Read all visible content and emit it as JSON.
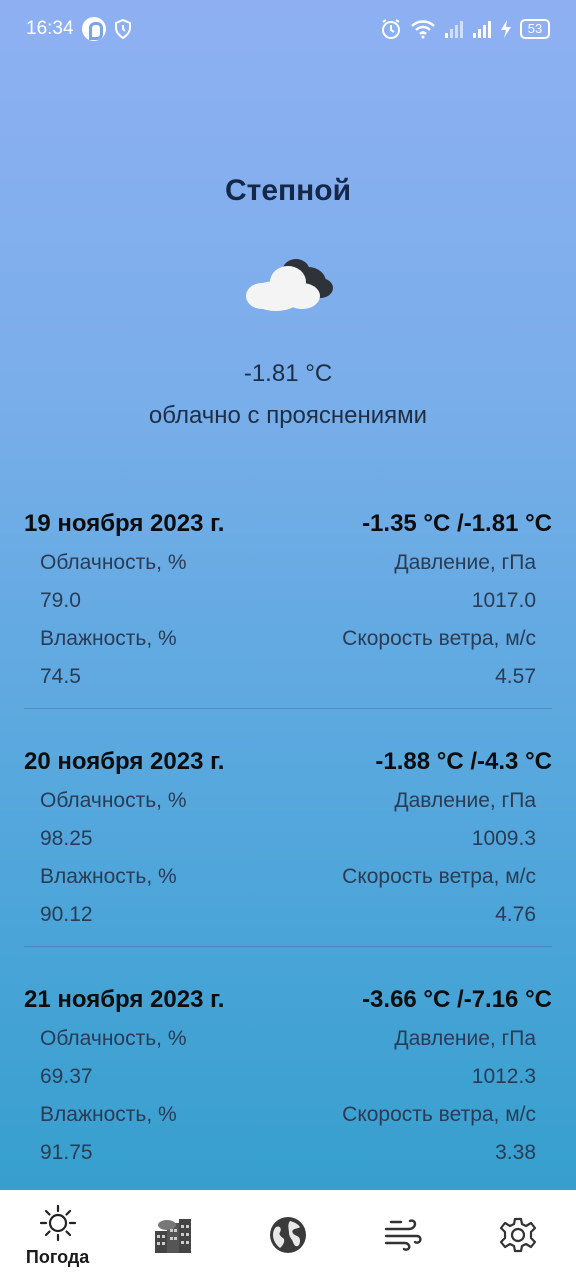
{
  "status_bar": {
    "time": "16:34",
    "battery": "53"
  },
  "current": {
    "city": "Степной",
    "temperature": "-1.81 °C",
    "description": "облачно с прояснениями",
    "icon": "partly-cloudy-icon"
  },
  "forecast": [
    {
      "date": "19 ноября 2023 г.",
      "temps": "-1.35 °C /-1.81 °C",
      "cloudiness_label": "Облачность, %",
      "cloudiness": "79.0",
      "pressure_label": "Давление, гПа",
      "pressure": "1017.0",
      "humidity_label": "Влажность, %",
      "humidity": "74.5",
      "wind_label": "Скорость ветра, м/с",
      "wind": "4.57"
    },
    {
      "date": "20 ноября 2023 г.",
      "temps": "-1.88 °C /-4.3 °C",
      "cloudiness_label": "Облачность, %",
      "cloudiness": "98.25",
      "pressure_label": "Давление, гПа",
      "pressure": "1009.3",
      "humidity_label": "Влажность, %",
      "humidity": "90.12",
      "wind_label": "Скорость ветра, м/с",
      "wind": "4.76"
    },
    {
      "date": "21 ноября 2023 г.",
      "temps": "-3.66 °C /-7.16 °C",
      "cloudiness_label": "Облачность, %",
      "cloudiness": "69.37",
      "pressure_label": "Давление, гПа",
      "pressure": "1012.3",
      "humidity_label": "Влажность, %",
      "humidity": "91.75",
      "wind_label": "Скорость ветра, м/с",
      "wind": "3.38"
    }
  ],
  "nav": {
    "weather_label": "Погода",
    "items": [
      "sun-icon",
      "city-buildings-icon",
      "globe-icon",
      "wind-icon",
      "gear-icon"
    ]
  },
  "colors": {
    "gradient_top": "#8eb0f3",
    "gradient_bottom": "#2f9dca",
    "city_text": "#15284a"
  }
}
